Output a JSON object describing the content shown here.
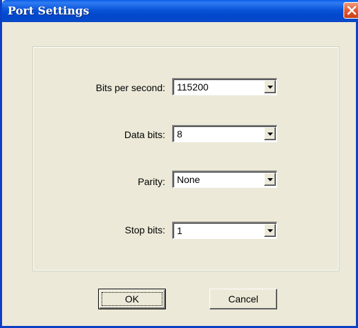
{
  "window": {
    "title": "Port Settings"
  },
  "fields": {
    "bits_per_second": {
      "label": "Bits per second:",
      "value": "115200"
    },
    "data_bits": {
      "label": "Data bits:",
      "value": "8"
    },
    "parity": {
      "label": "Parity:",
      "value": "None"
    },
    "stop_bits": {
      "label": "Stop bits:",
      "value": "1"
    }
  },
  "buttons": {
    "ok": "OK",
    "cancel": "Cancel"
  },
  "icons": {
    "close": "close-icon",
    "dropdown": "chevron-down-icon"
  },
  "colors": {
    "titlebar": "#0054e3",
    "close": "#e0562c",
    "background": "#ece9d8"
  }
}
